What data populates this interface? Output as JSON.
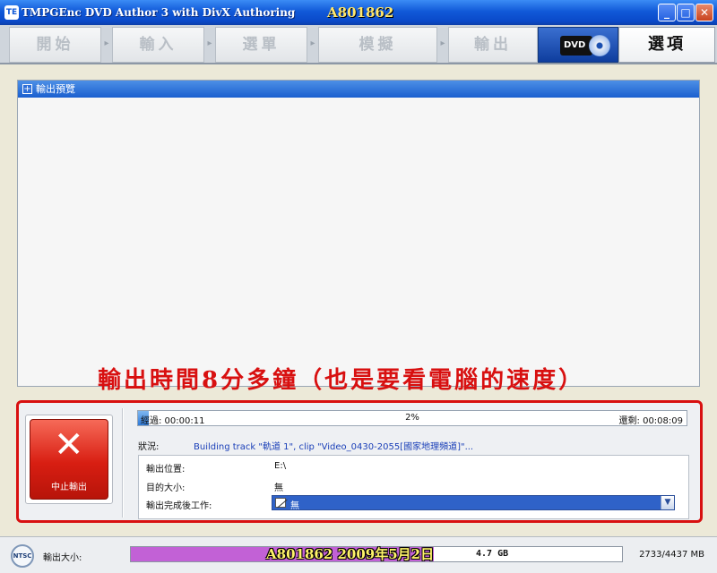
{
  "window": {
    "title": "TMPGEnc DVD Author 3 with DivX Authoring",
    "watermark_top": "A801862",
    "minimize_glyph": "_",
    "maximize_glyph": "□",
    "close_glyph": "✕"
  },
  "nav": {
    "steps": [
      {
        "label": "開始"
      },
      {
        "label": "輸入"
      },
      {
        "label": "選單"
      },
      {
        "label": "模擬"
      },
      {
        "label": "輸出"
      }
    ],
    "arrow_glyph": "▸",
    "dvd_logo_text": "DVD",
    "options_label": "選項"
  },
  "preview": {
    "header_label": "輸出預覽",
    "expand_glyph": "+"
  },
  "annotation": {
    "text": "輸出時間8分多鐘（也是要看電腦的速度）"
  },
  "output": {
    "stop_label": "中止輸出",
    "progress_fraction": 0.02,
    "elapsed_text": "經過: 00:00:11",
    "percent_text": "2%",
    "remaining_text": "還剩: 00:08:09",
    "status_label": "狀況:",
    "status_text": "Building track \"軌道 1\", clip \"Video_0430-2055[國家地理頻道]\"...",
    "location_label": "輸出位置:",
    "location_value": "E:\\",
    "target_size_label": "目的大小:",
    "target_size_value": "無",
    "after_label": "輸出完成後工作:",
    "after_value": "無",
    "dropdown_glyph": "▼"
  },
  "statusbar": {
    "ntsc_label": "NTSC",
    "size_label": "輸出大小:",
    "usage_fraction": 0.616,
    "capacity_text": "4.7 GB",
    "watermark_bottom": "A801862  2009年5月2日",
    "mb_text": "2733/4437  MB"
  },
  "colors": {
    "accent_blue": "#1159d8",
    "stop_red": "#d81e12",
    "annotation_red": "#d81010",
    "usage_purple": "#c261d6"
  }
}
